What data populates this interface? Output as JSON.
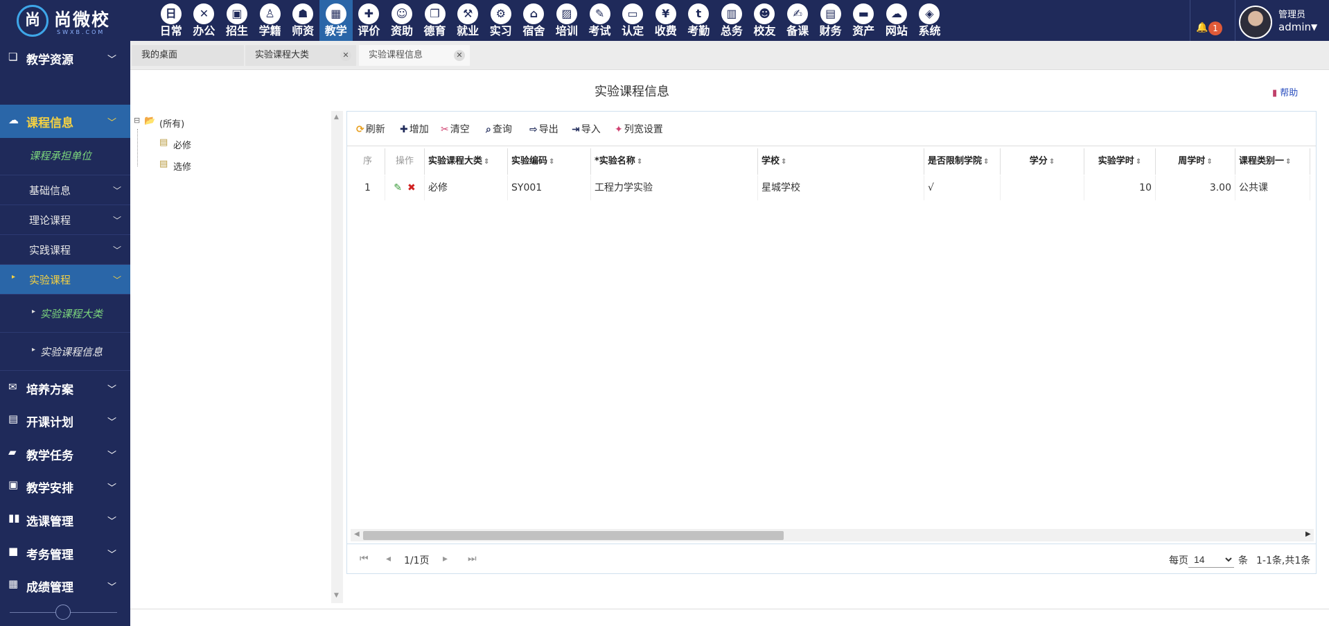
{
  "logo": {
    "mark": "尚",
    "name": "尚微校",
    "sub": "SWXB.COM"
  },
  "modules": [
    {
      "label": "日常",
      "icon": "日"
    },
    {
      "label": "办公",
      "icon": "✕"
    },
    {
      "label": "招生",
      "icon": "▣"
    },
    {
      "label": "学籍",
      "icon": "♙"
    },
    {
      "label": "师资",
      "icon": "☗"
    },
    {
      "label": "教学",
      "icon": "▦"
    },
    {
      "label": "评价",
      "icon": "✚"
    },
    {
      "label": "资助",
      "icon": "☺"
    },
    {
      "label": "德育",
      "icon": "❒"
    },
    {
      "label": "就业",
      "icon": "⚒"
    },
    {
      "label": "实习",
      "icon": "⚙"
    },
    {
      "label": "宿舍",
      "icon": "⌂"
    },
    {
      "label": "培训",
      "icon": "▨"
    },
    {
      "label": "考试",
      "icon": "✎"
    },
    {
      "label": "认定",
      "icon": "▭"
    },
    {
      "label": "收费",
      "icon": "¥"
    },
    {
      "label": "考勤",
      "icon": "t"
    },
    {
      "label": "总务",
      "icon": "▥"
    },
    {
      "label": "校友",
      "icon": "☻"
    },
    {
      "label": "备课",
      "icon": "✍"
    },
    {
      "label": "财务",
      "icon": "▤"
    },
    {
      "label": "资产",
      "icon": "▬"
    },
    {
      "label": "网站",
      "icon": "☁"
    },
    {
      "label": "系统",
      "icon": "◈"
    }
  ],
  "active_module": "教学",
  "notifications": {
    "count": "1"
  },
  "user": {
    "role": "管理员",
    "account": "admin"
  },
  "sidebar": {
    "teaching_resources": "教学资源",
    "course_info": "课程信息",
    "course_unit": "课程承担单位",
    "basic_info": "基础信息",
    "theory_course": "理论课程",
    "practice_course": "实践课程",
    "lab_course": "实验课程",
    "lab_category": "实验课程大类",
    "lab_info": "实验课程信息",
    "training_plan": "培养方案",
    "course_plan": "开课计划",
    "teaching_task": "教学任务",
    "teaching_schedule": "教学安排",
    "course_selection": "选课管理",
    "exam_mgmt": "考务管理",
    "grade_mgmt": "成绩管理"
  },
  "tabs": {
    "desktop": "我的桌面",
    "lab_category": "实验课程大类",
    "lab_info": "实验课程信息",
    "close": "✕"
  },
  "page": {
    "title": "实验课程信息",
    "help": "帮助"
  },
  "tree": {
    "root": "(所有)",
    "children": [
      "必修",
      "选修"
    ]
  },
  "toolbar": {
    "refresh": "刷新",
    "add": "增加",
    "clear": "清空",
    "query": "查询",
    "export": "导出",
    "import": "导入",
    "colwidth": "列宽设置"
  },
  "table": {
    "headers": [
      "序",
      "操作",
      "实验课程大类",
      "实验编码",
      "*实验名称",
      "学校",
      "是否限制学院",
      "学分",
      "实验学时",
      "周学时",
      "课程类别一"
    ],
    "rows": [
      {
        "idx": "1",
        "category": "必修",
        "code": "SY001",
        "name": "工程力学实验",
        "school": "星城学校",
        "limit": "√",
        "credit": "",
        "hours": "10",
        "weekly": "3.00",
        "type": "公共课"
      }
    ]
  },
  "pager": {
    "page": "1/1页",
    "per_page_label": "每页",
    "per_page": "14",
    "unit": "条",
    "summary": "1-1条,共1条"
  },
  "colors": {
    "nav_bg": "#1f2a5a",
    "active_bg": "#2a66a8",
    "highlight": "#f5d142",
    "link": "#7cd67c"
  }
}
